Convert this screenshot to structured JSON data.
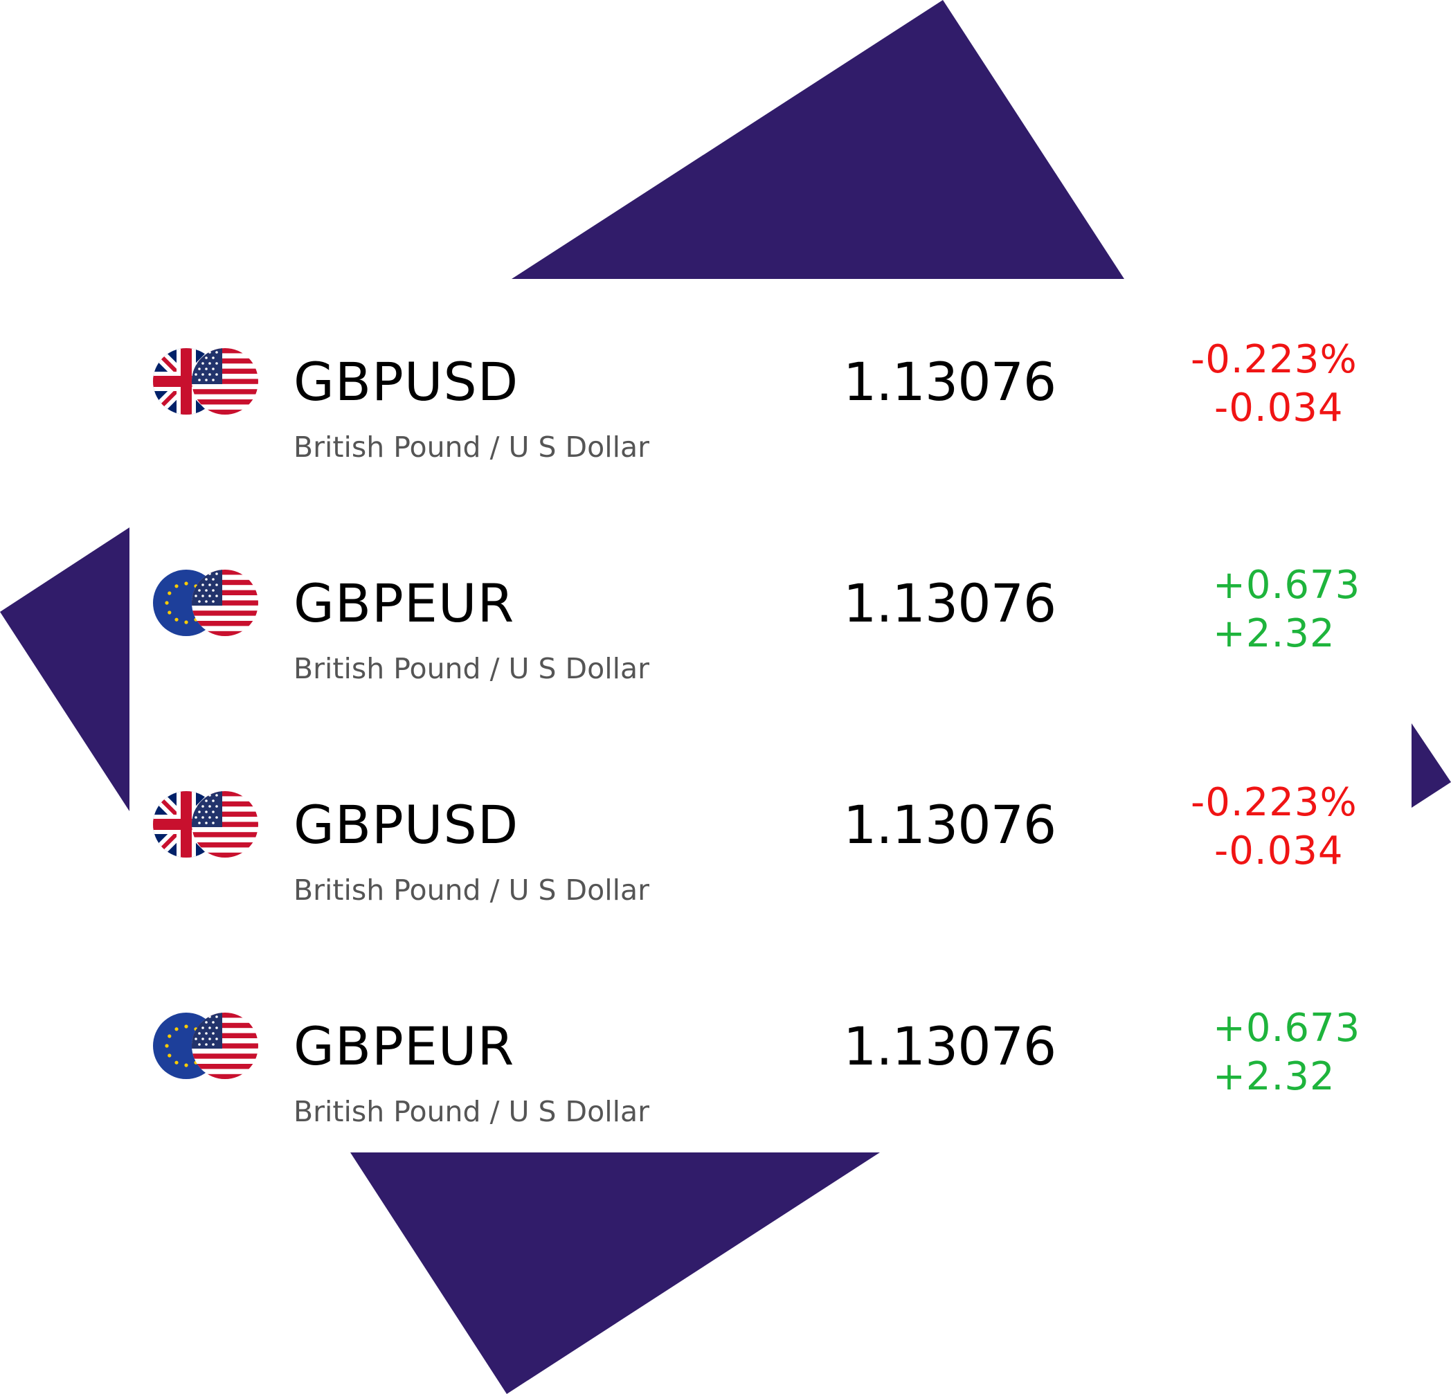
{
  "colors": {
    "background": "#ffffff",
    "decor": "#311c6a",
    "negative": "#f01414",
    "positive": "#1eb43c",
    "symbol_text": "#000000",
    "description_text": "#555555"
  },
  "tickers": [
    {
      "symbol": "GBPUSD",
      "description": "British Pound / U S Dollar",
      "price": "1.13076",
      "change_primary": "-0.223%",
      "change_secondary": "-0.034",
      "direction": "negative",
      "base_flag": "uk-flag-icon",
      "quote_flag": "us-flag-icon"
    },
    {
      "symbol": "GBPEUR",
      "description": "British Pound / U S Dollar",
      "price": "1.13076",
      "change_primary": "+0.673",
      "change_secondary": "+2.32",
      "direction": "positive",
      "base_flag": "eu-flag-icon",
      "quote_flag": "us-flag-icon"
    },
    {
      "symbol": "GBPUSD",
      "description": "British Pound / U S Dollar",
      "price": "1.13076",
      "change_primary": "-0.223%",
      "change_secondary": "-0.034",
      "direction": "negative",
      "base_flag": "uk-flag-icon",
      "quote_flag": "us-flag-icon"
    },
    {
      "symbol": "GBPEUR",
      "description": "British Pound / U S Dollar",
      "price": "1.13076",
      "change_primary": "+0.673",
      "change_secondary": "+2.32",
      "direction": "positive",
      "base_flag": "eu-flag-icon",
      "quote_flag": "us-flag-icon"
    }
  ]
}
